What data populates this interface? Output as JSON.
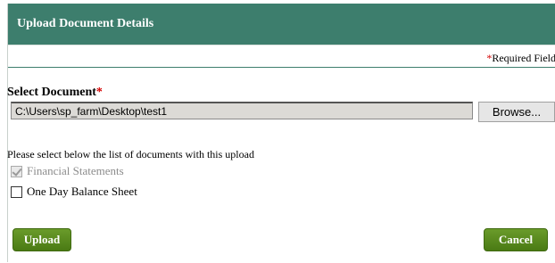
{
  "dialog": {
    "title": "Upload Document Details",
    "required_asterisk": "*",
    "required_text": "Required Field"
  },
  "form": {
    "select_label": "Select Document",
    "select_asterisk": "*",
    "file_path": "C:\\Users\\sp_farm\\Desktop\\test1",
    "browse_label": "Browse...",
    "instructions": "Please select below the list of documents with this upload",
    "options": [
      {
        "label": "Financial Statements",
        "checked": true,
        "disabled": true
      },
      {
        "label": "One Day Balance Sheet",
        "checked": false,
        "disabled": false
      }
    ]
  },
  "actions": {
    "upload_label": "Upload",
    "cancel_label": "Cancel"
  },
  "colors": {
    "header_bg": "#3d7e6d",
    "button_green": "#5a8a1e",
    "required_red": "#d40000"
  }
}
